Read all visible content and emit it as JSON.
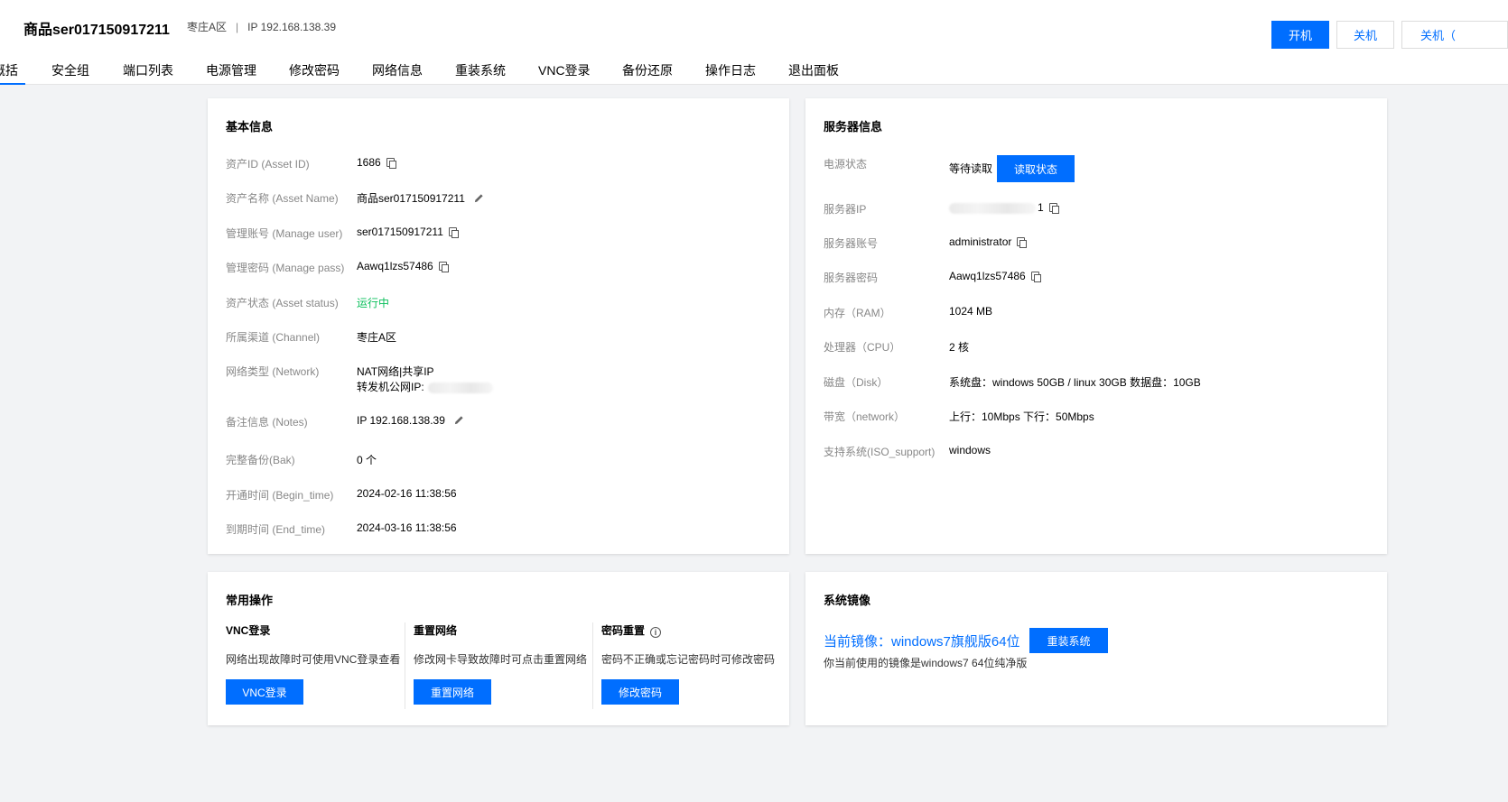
{
  "header": {
    "title": "商品ser017150917211",
    "channel": "枣庄A区",
    "separator": "|",
    "ip": "IP 192.168.138.39",
    "buttons": [
      "开机",
      "关机",
      "关机（"
    ]
  },
  "tabs": [
    "概括",
    "安全组",
    "端口列表",
    "电源管理",
    "修改密码",
    "网络信息",
    "重装系统",
    "VNC登录",
    "备份还原",
    "操作日志",
    "退出面板"
  ],
  "basic_info": {
    "title": "基本信息",
    "rows": [
      {
        "label": "资产ID (Asset ID)",
        "value": "1686"
      },
      {
        "label": "资产名称 (Asset Name)",
        "value": "商品ser017150917211"
      },
      {
        "label": "管理账号 (Manage user)",
        "value": "ser017150917211"
      },
      {
        "label": "管理密码 (Manage pass)",
        "value": "Aawq1lzs57486"
      },
      {
        "label": "资产状态 (Asset status)",
        "value": "运行中"
      },
      {
        "label": "所属渠道 (Channel)",
        "value": "枣庄A区"
      },
      {
        "label": "网络类型 (Network)",
        "value": "NAT网络|共享IP",
        "value2": "转发机公网IP:"
      },
      {
        "label": "备注信息 (Notes)",
        "value": "IP 192.168.138.39"
      },
      {
        "label": "完整备份(Bak)",
        "value": "0 个"
      },
      {
        "label": "开通时间 (Begin_time)",
        "value": "2024-02-16 11:38:56"
      },
      {
        "label": "到期时间 (End_time)",
        "value": "2024-03-16 11:38:56"
      }
    ]
  },
  "server_info": {
    "title": "服务器信息",
    "rows": [
      {
        "label": "电源状态",
        "value": "等待读取",
        "button": "读取状态"
      },
      {
        "label": "服务器IP",
        "value": "1"
      },
      {
        "label": "服务器账号",
        "value": "administrator"
      },
      {
        "label": "服务器密码",
        "value": "Aawq1lzs57486"
      },
      {
        "label": "内存（RAM）",
        "value": "1024 MB"
      },
      {
        "label": "处理器（CPU）",
        "value": "2 核"
      },
      {
        "label": "磁盘（Disk）",
        "value": "系统盘：windows 50GB / linux 30GB 数据盘：10GB"
      },
      {
        "label": "带宽（network）",
        "value": "上行：10Mbps 下行：50Mbps"
      },
      {
        "label": "支持系统(ISO_support)",
        "value": "windows"
      }
    ]
  },
  "common_ops": {
    "title": "常用操作",
    "ops": [
      {
        "title": "VNC登录",
        "desc": "网络出现故障时可使用VNC登录查看",
        "button": "VNC登录"
      },
      {
        "title": "重置网络",
        "desc": "修改网卡导致故障时可点击重置网络",
        "button": "重置网络"
      },
      {
        "title": "密码重置",
        "info": "i",
        "desc": "密码不正确或忘记密码时可修改密码",
        "button": "修改密码"
      }
    ]
  },
  "system_image": {
    "title": "系统镜像",
    "current": "当前镜像：windows7旗舰版64位",
    "button": "重装系统",
    "desc": "你当前使用的镜像是windows7 64位纯净版"
  },
  "colors": {
    "accent": "#006eff",
    "running": "#0abf5b",
    "background": "#f2f3f5"
  }
}
